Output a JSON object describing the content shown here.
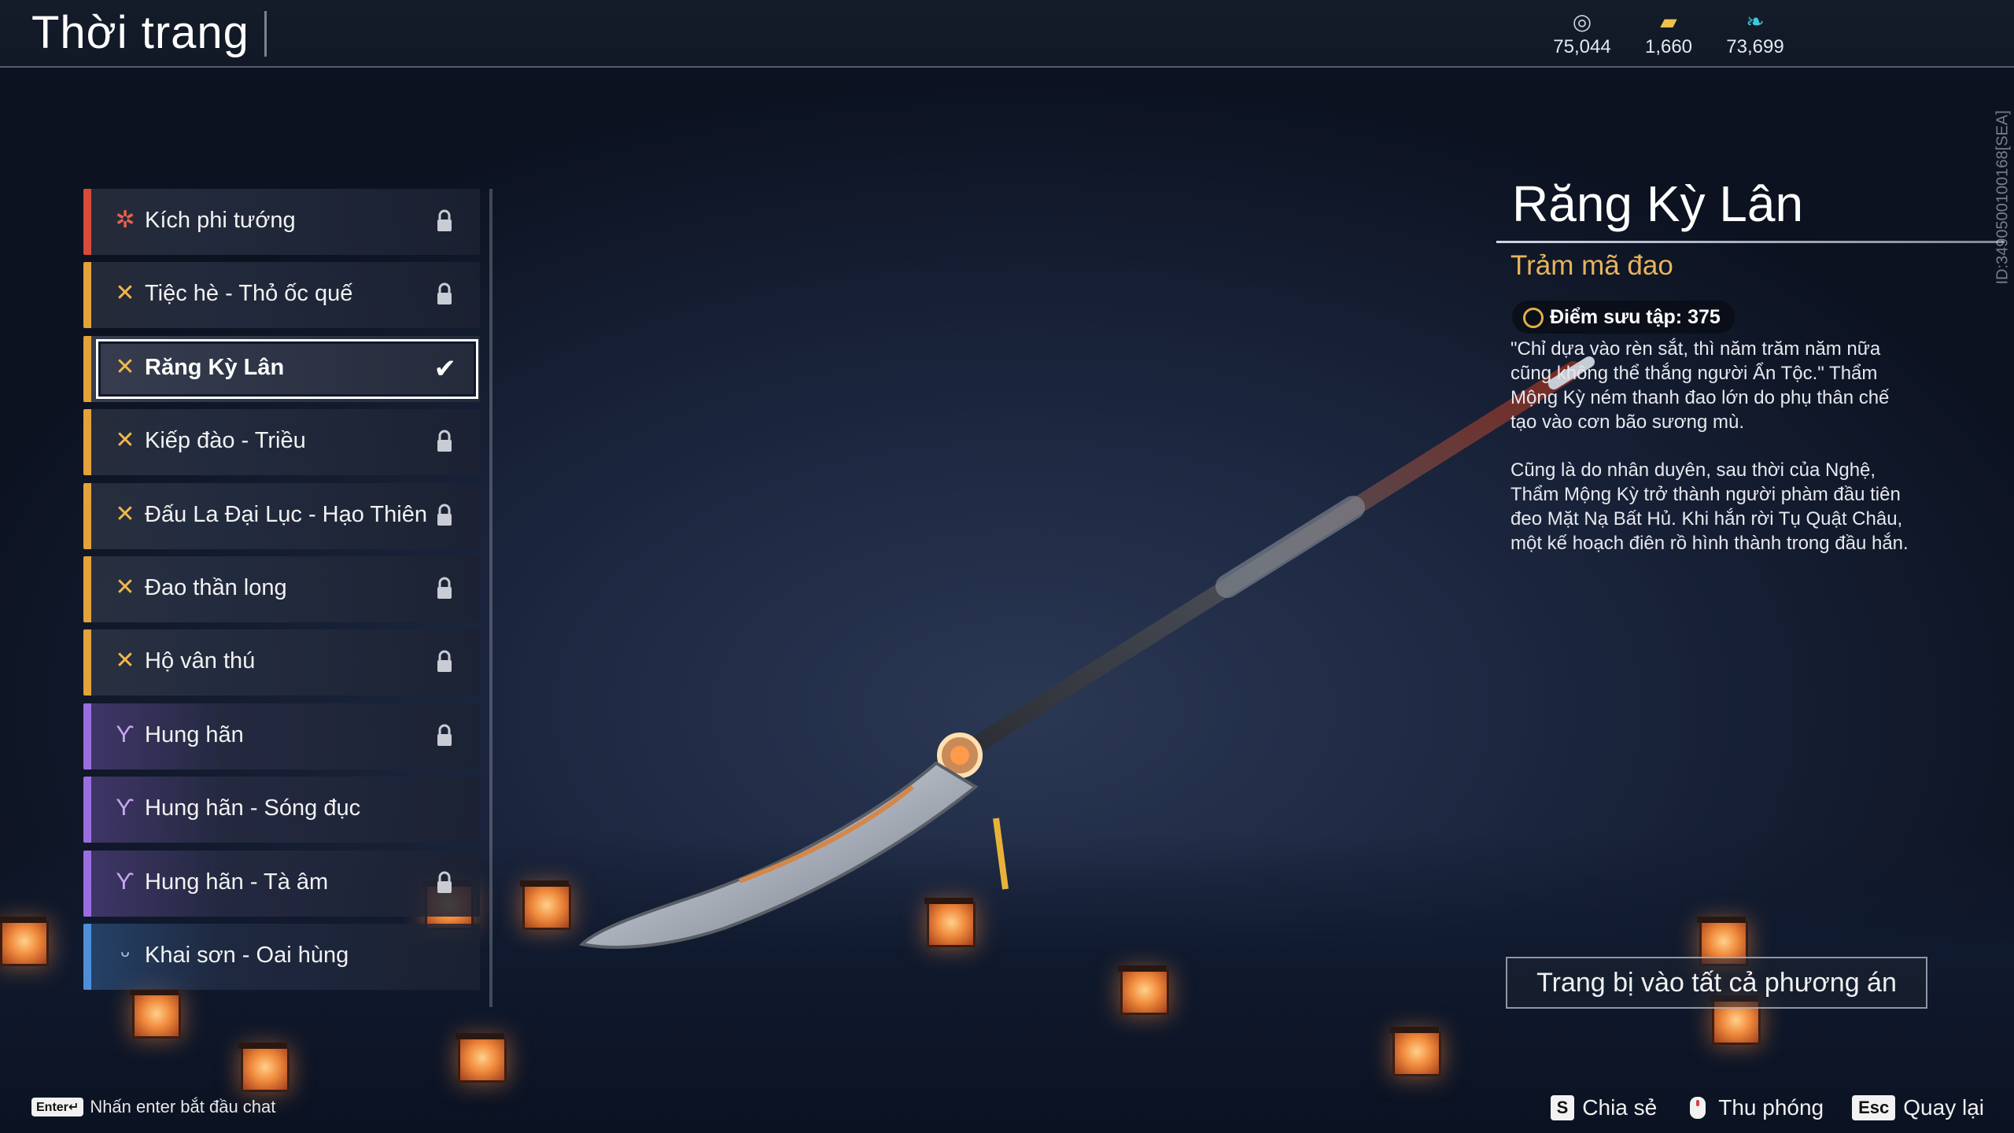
{
  "header": {
    "title": "Thời trang"
  },
  "currencies": [
    {
      "icon": "silver-coin-icon",
      "value": "75,044"
    },
    {
      "icon": "gold-ingot-icon",
      "value": "1,660"
    },
    {
      "icon": "jade-feather-icon",
      "value": "73,699"
    }
  ],
  "list": {
    "items": [
      {
        "label": "Kích phi tướng",
        "tier": "red",
        "locked": true
      },
      {
        "label": "Tiệc hè - Thỏ ốc quế",
        "tier": "gold",
        "locked": true
      },
      {
        "label": "Răng Kỳ Lân",
        "tier": "gold",
        "selected": true
      },
      {
        "label": "Kiếp đào - Triều",
        "tier": "gold",
        "locked": true
      },
      {
        "label": "Đấu La Đại Lục - Hạo Thiên",
        "tier": "gold",
        "locked": true
      },
      {
        "label": "Đao thần long",
        "tier": "gold",
        "locked": true
      },
      {
        "label": "Hộ vân thú",
        "tier": "gold",
        "locked": true
      },
      {
        "label": "Hung hãn",
        "tier": "purple",
        "locked": true
      },
      {
        "label": "Hung hãn - Sóng đục",
        "tier": "purple",
        "locked": false
      },
      {
        "label": "Hung hãn - Tà âm",
        "tier": "purple",
        "locked": true
      },
      {
        "label": "Khai sơn - Oai hùng",
        "tier": "blue",
        "locked": false
      }
    ]
  },
  "detail": {
    "name": "Răng Kỳ Lân",
    "type": "Trảm mã đao",
    "points": "Điểm sưu tập: 375",
    "desc1": "\"Chỉ dựa vào rèn sắt, thì năm trăm năm nữa cũng không thể thắng người Ẩn Tộc.\" Thẩm Mộng Kỳ ném thanh đao lớn do phụ thân chế tạo vào cơn bão sương mù.",
    "desc2": "Cũng là do nhân duyên, sau thời của Nghệ, Thẩm Mộng Kỳ trở thành người phàm đầu tiên đeo Mặt Nạ Bất Hủ. Khi hắn rời Tụ Quật Châu, một kế hoạch điên rồ hình thành trong đầu hắn.",
    "equip_button": "Trang bị vào tất cả phương án"
  },
  "side_id": "ID:3490500100168[SEA]",
  "footer": {
    "enter_key": "Enter↵",
    "chat_hint": "Nhấn enter bắt đầu chat",
    "share_key": "S",
    "share_label": "Chia sẻ",
    "zoom_label": "Thu phóng",
    "back_key": "Esc",
    "back_label": "Quay lại"
  },
  "colors": {
    "red": "#d84a3a",
    "gold": "#e3a23a",
    "purple": "#9a6ee0",
    "blue": "#4d8fd8",
    "accent": "#e9b45a"
  }
}
